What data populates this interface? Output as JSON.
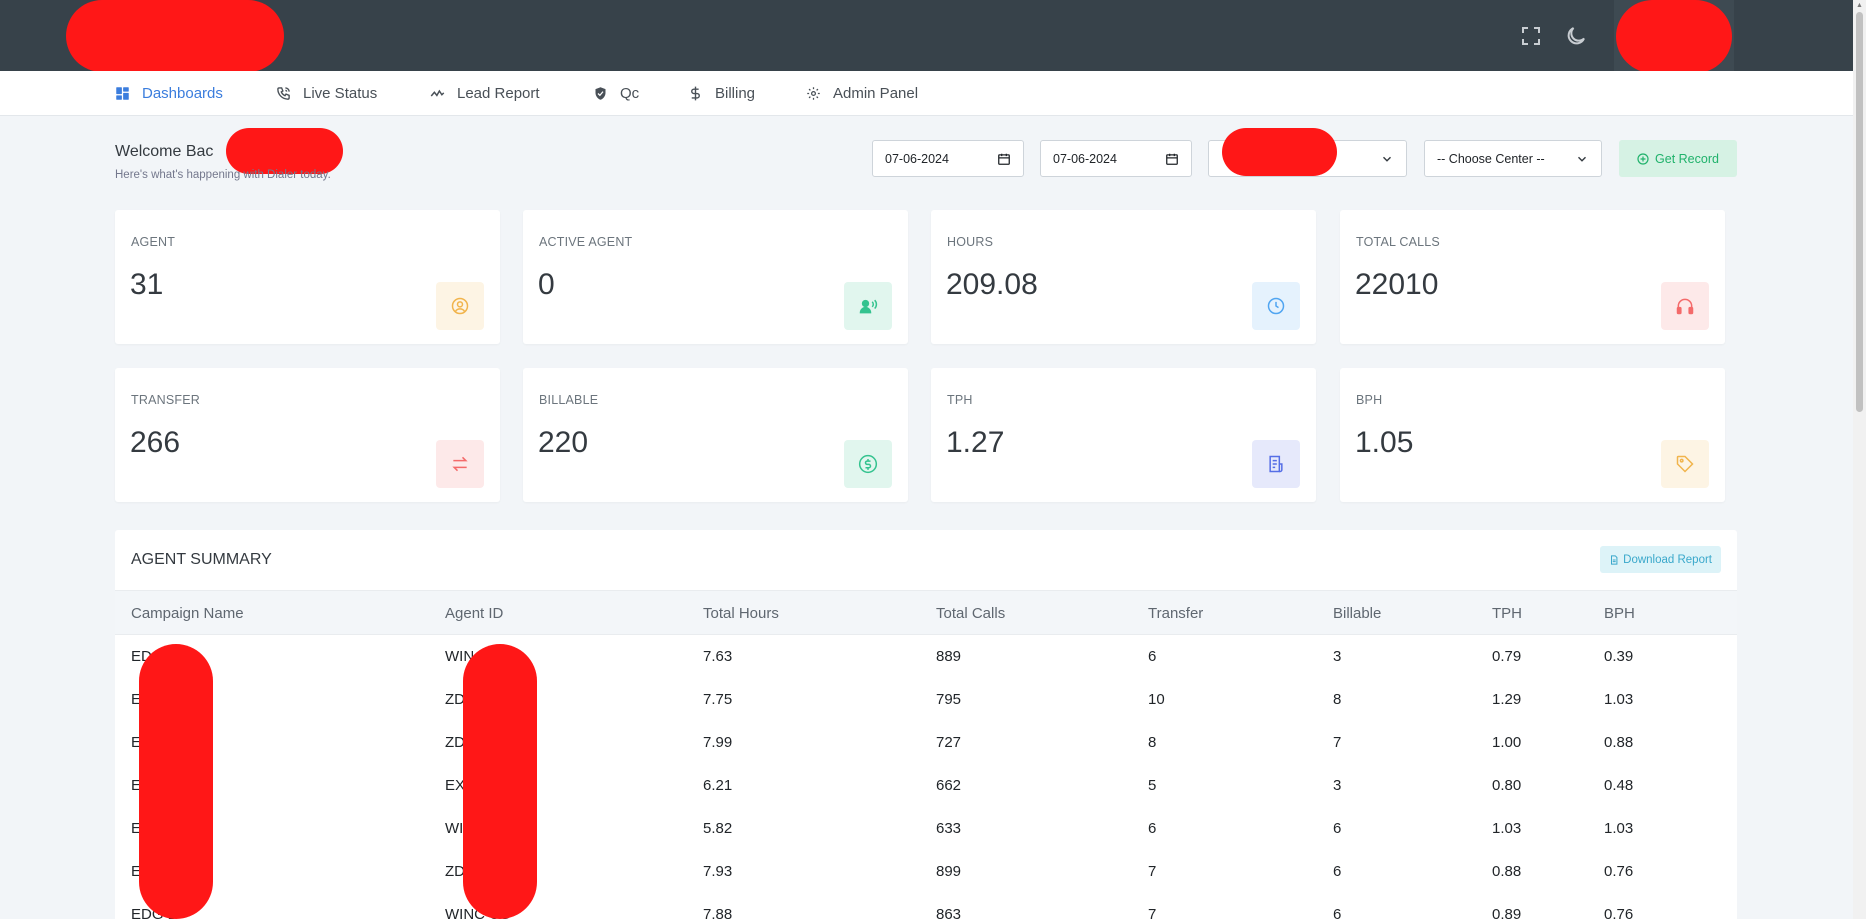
{
  "nav": {
    "items": [
      {
        "label": "Dashboards",
        "icon": "dashboard-icon",
        "active": true
      },
      {
        "label": "Live Status",
        "icon": "phone-icon"
      },
      {
        "label": "Lead Report",
        "icon": "activity-icon"
      },
      {
        "label": "Qc",
        "icon": "shield-check-icon"
      },
      {
        "label": "Billing",
        "icon": "dollar-icon"
      },
      {
        "label": "Admin Panel",
        "icon": "gear-icon"
      }
    ]
  },
  "welcome": {
    "title": "Welcome Bac",
    "subtitle": "Here's what's happening with Dialer today."
  },
  "filters": {
    "date_from": "07-06-2024",
    "date_to": "07-06-2024",
    "campaign_select": "",
    "center_select": "-- Choose Center --",
    "get_record_label": "Get Record"
  },
  "stats": [
    {
      "label": "AGENT",
      "value": "31",
      "icon": "user-circle-icon",
      "color": "#f1b44c"
    },
    {
      "label": "ACTIVE AGENT",
      "value": "0",
      "icon": "user-voice-icon",
      "color": "#34c38f"
    },
    {
      "label": "HOURS",
      "value": "209.08",
      "icon": "clock-icon",
      "color": "#50a5f1"
    },
    {
      "label": "TOTAL CALLS",
      "value": "22010",
      "icon": "headphones-icon",
      "color": "#f46a6a"
    },
    {
      "label": "TRANSFER",
      "value": "266",
      "icon": "transfer-icon",
      "color": "#f46a6a"
    },
    {
      "label": "BILLABLE",
      "value": "220",
      "icon": "dollar-circle-icon",
      "color": "#34c38f"
    },
    {
      "label": "TPH",
      "value": "1.27",
      "icon": "receipt-icon",
      "color": "#556ee6"
    },
    {
      "label": "BPH",
      "value": "1.05",
      "icon": "tag-icon",
      "color": "#f1b44c"
    }
  ],
  "summary": {
    "title": "AGENT SUMMARY",
    "download_label": "Download Report",
    "columns": [
      "Campaign Name",
      "Agent ID",
      "Total Hours",
      "Total Calls",
      "Transfer",
      "Billable",
      "TPH",
      "BPH"
    ],
    "rows": [
      [
        "ED",
        "WIN US",
        "7.63",
        "889",
        "6",
        "3",
        "0.79",
        "0.39"
      ],
      [
        "E",
        "ZD S",
        "7.75",
        "795",
        "10",
        "8",
        "1.29",
        "1.03"
      ],
      [
        "E",
        "ZD S",
        "7.99",
        "727",
        "8",
        "7",
        "1.00",
        "0.88"
      ],
      [
        "E",
        "EX S",
        "6.21",
        "662",
        "5",
        "3",
        "0.80",
        "0.48"
      ],
      [
        "E",
        "WI S",
        "5.82",
        "633",
        "6",
        "6",
        "1.03",
        "1.03"
      ],
      [
        "E",
        "ZD S",
        "7.93",
        "899",
        "7",
        "6",
        "0.88",
        "0.76"
      ],
      [
        "EDG D",
        "WINC US",
        "7.88",
        "863",
        "7",
        "6",
        "0.89",
        "0.76"
      ]
    ]
  }
}
